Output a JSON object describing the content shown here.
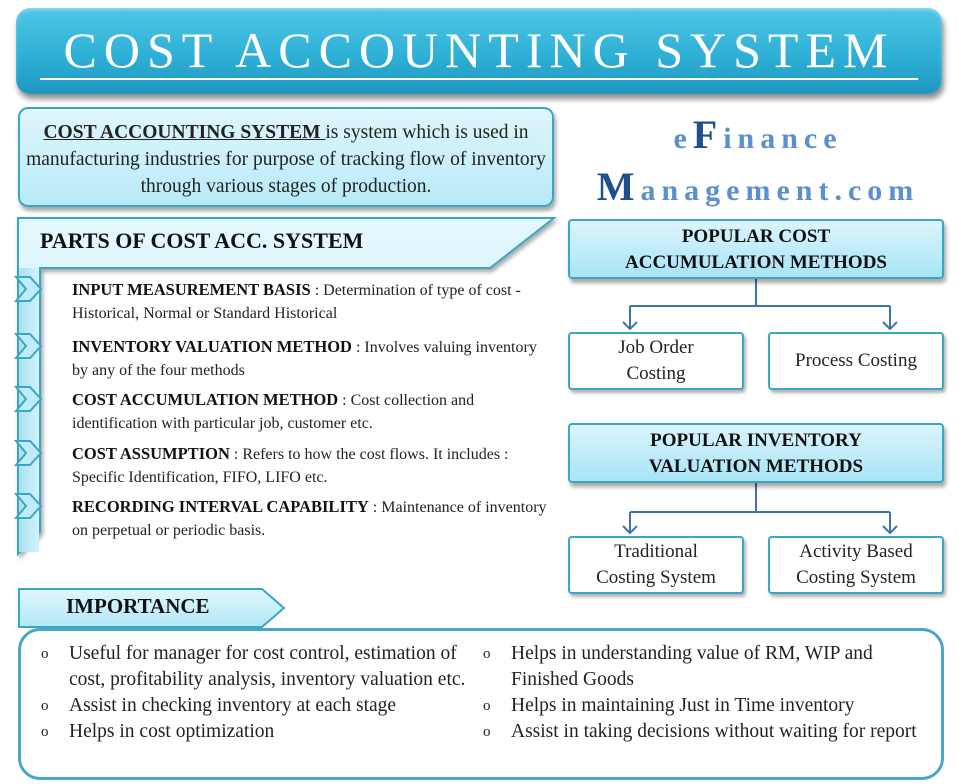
{
  "title": "COST ACCOUNTING SYSTEM",
  "definition": {
    "term": "COST ACCOUNTING SYSTEM ",
    "text": "is system which is used in manufacturing industries for purpose of tracking flow of inventory through various stages of production."
  },
  "logo": {
    "line1_cap_prefix": "e",
    "line1_cap": "F",
    "line1_rest": "inance",
    "line2_cap": "M",
    "line2_rest": "anagement.com"
  },
  "parts": {
    "heading": "PARTS OF COST ACC. SYSTEM",
    "items": [
      {
        "term": "INPUT MEASUREMENT BASIS",
        "desc": " : Determination of type of cost -  Historical, Normal or Standard Historical"
      },
      {
        "term": "INVENTORY VALUATION METHOD",
        "desc": " : Involves valuing inventory by any of the four methods"
      },
      {
        "term": "COST ACCUMULATION METHOD",
        "desc": " : Cost collection and identification with particular job, customer etc."
      },
      {
        "term": "COST ASSUMPTION",
        "desc": " : Refers to how the cost flows. It includes : Specific Identification, FIFO, LIFO etc."
      },
      {
        "term": "RECORDING INTERVAL CAPABILITY",
        "desc": " : Maintenance of inventory on perpetual or periodic basis."
      }
    ]
  },
  "cost_accumulation": {
    "heading_line1": "POPULAR COST",
    "heading_line2": "ACCUMULATION METHODS",
    "children": [
      {
        "line1": "Job Order",
        "line2": "Costing"
      },
      {
        "line1": "Process Costing",
        "line2": ""
      }
    ]
  },
  "inventory_valuation": {
    "heading_line1": "POPULAR INVENTORY",
    "heading_line2": "VALUATION METHODS",
    "children": [
      {
        "line1": "Traditional",
        "line2": "Costing System"
      },
      {
        "line1": "Activity Based",
        "line2": "Costing System"
      }
    ]
  },
  "importance": {
    "heading": "IMPORTANCE",
    "bullet_glyph": "o",
    "left": [
      "Useful for manager for cost control, estimation of cost, profitability analysis, inventory valuation etc.",
      "Assist in checking inventory at each stage",
      "Helps in cost optimization"
    ],
    "right": [
      "Helps in understanding value of RM, WIP and Finished Goods",
      "Helps in maintaining Just in Time inventory",
      "Assist in taking decisions without waiting for report"
    ]
  },
  "colors": {
    "banner": "#2fb0d6",
    "border": "#3aa6c4",
    "panel_fill": "#b8eaf8",
    "logo_light": "#5b8fd0",
    "logo_dark": "#1f4f8c",
    "connector": "#3f72b0"
  }
}
